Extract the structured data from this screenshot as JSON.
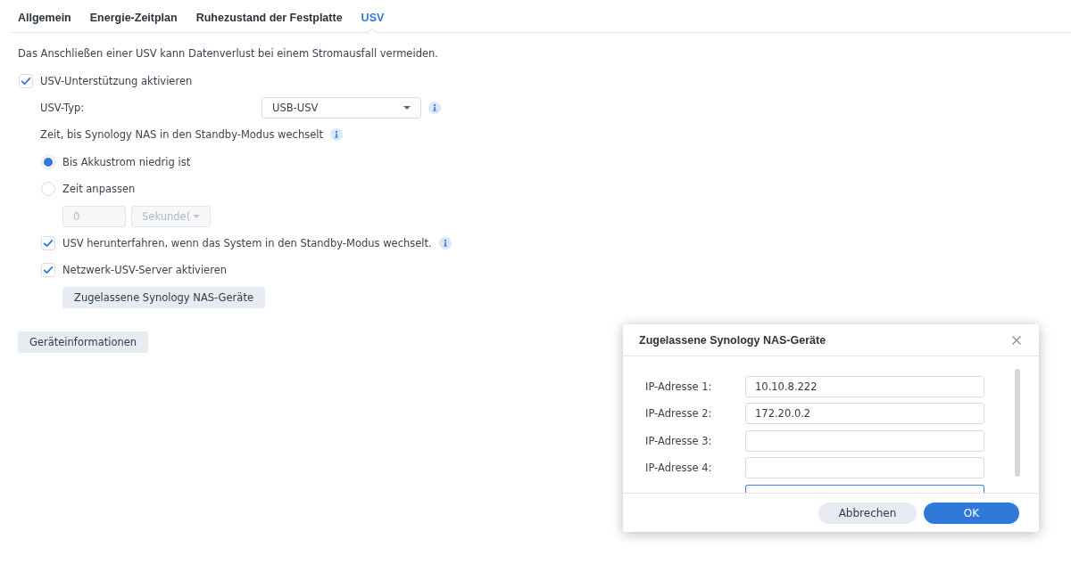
{
  "tabs": [
    {
      "label": "Allgemein",
      "selected": false
    },
    {
      "label": "Energie-Zeitplan",
      "selected": false
    },
    {
      "label": "Ruhezustand der Festplatte",
      "selected": false
    },
    {
      "label": "USV",
      "selected": true
    }
  ],
  "description": "Das Anschließen einer USV kann Datenverlust bei einem Stromausfall vermeiden.",
  "ups_support": {
    "label": "USV-Unterstützung aktivieren",
    "checked": true
  },
  "ups_type": {
    "label": "USV-Typ:",
    "value": "USB-USV"
  },
  "standby_time": {
    "label": "Zeit, bis Synology NAS in den Standby-Modus wechselt",
    "options": [
      {
        "label": "Bis Akkustrom niedrig ist",
        "selected": true
      },
      {
        "label": "Zeit anpassen",
        "selected": false
      }
    ],
    "time_value": "0",
    "time_unit": "Sekunde(",
    "disabled": true
  },
  "options": [
    {
      "label": "USV herunterfahren, wenn das System in den Standby-Modus wechselt.",
      "checked": true,
      "info": true
    },
    {
      "label": "Netzwerk-USV-Server aktivieren",
      "checked": true,
      "info": false
    }
  ],
  "allowed_devices_button": "Zugelassene Synology NAS-Geräte",
  "device_info_button": "Geräteinformationen",
  "dialog": {
    "title": "Zugelassene Synology NAS-Geräte",
    "rows": [
      {
        "label": "IP-Adresse 1:",
        "value": "10.10.8.222",
        "focused": false
      },
      {
        "label": "IP-Adresse 2:",
        "value": "172.20.0.2",
        "focused": false
      },
      {
        "label": "IP-Adresse 3:",
        "focused": false
      },
      {
        "label": "IP-Adresse 4:",
        "focused": false
      },
      {
        "focused": true
      }
    ],
    "buttons": [
      {
        "label": "Abbrechen",
        "kind": "secondary"
      },
      {
        "label": "OK",
        "kind": "primary"
      }
    ]
  }
}
